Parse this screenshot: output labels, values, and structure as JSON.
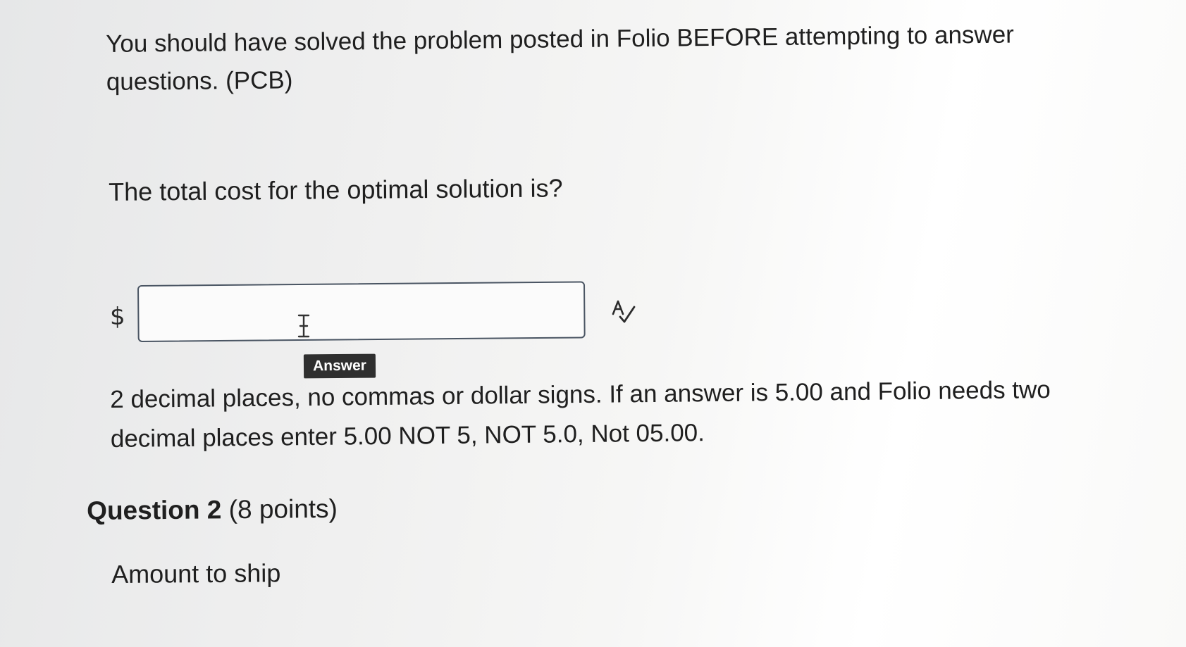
{
  "question1": {
    "intro_line1": "You should have solved the problem posted in Folio BEFORE attempting to answer",
    "intro_line2": "questions. (PCB)",
    "prompt": "The total cost for the optimal solution is?",
    "currency_symbol": "$",
    "answer_value": "",
    "answer_placeholder": "Answer",
    "tooltip": "Answer",
    "instructions_line1": "2 decimal places, no commas or dollar signs. If an answer is 5.00 and Folio needs two",
    "instructions_line2": "decimal places enter 5.00 NOT 5, NOT 5.0, Not 05.00."
  },
  "question2": {
    "title": "Question 2",
    "points": "(8 points)",
    "prompt": "Amount to ship"
  },
  "icons": {
    "text_cursor": "text-cursor-icon",
    "spellcheck": "spellcheck-icon"
  },
  "colors": {
    "input_border": "#4a5563",
    "tooltip_background": "#2f2f2f",
    "text": "#1f1f1f"
  }
}
